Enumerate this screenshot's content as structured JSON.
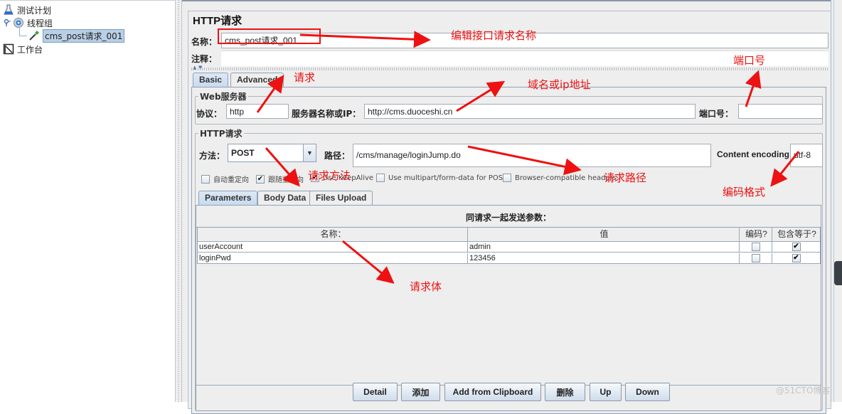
{
  "tree": {
    "items": [
      {
        "label": "测试计划",
        "icon": "flask-icon"
      },
      {
        "label": "线程组",
        "icon": "gear-icon"
      },
      {
        "label": "cms_post请求_001",
        "icon": "pipette-icon",
        "selected": true
      },
      {
        "label": "工作台",
        "icon": "notepad-icon"
      }
    ]
  },
  "panel": {
    "title": "HTTP请求",
    "name_label": "名称：",
    "name_value": "cms_post请求_001",
    "comment_label": "注释：",
    "comment_value": ""
  },
  "tabs": [
    {
      "label": "Basic",
      "active": true
    },
    {
      "label": "Advanced",
      "active": false
    }
  ],
  "web_server": {
    "group_title": "Web服务器",
    "protocol_label": "协议：",
    "protocol_value": "http",
    "server_label": "服务器名称或IP：",
    "server_value": "http://cms.duoceshi.cn",
    "port_label": "端口号：",
    "port_value": ""
  },
  "http_request": {
    "group_title": "HTTP请求",
    "method_label": "方法：",
    "method_value": "POST",
    "path_label": "路径：",
    "path_value": "/cms/manage/loginJump.do",
    "encoding_label": "Content encoding:",
    "encoding_value": "utf-8"
  },
  "options": [
    {
      "label": "自动重定向",
      "checked": false
    },
    {
      "label": "跟随重定向",
      "checked": true
    },
    {
      "label": "Use KeepAlive",
      "checked": true
    },
    {
      "label": "Use multipart/form-data for POST",
      "checked": false
    },
    {
      "label": "Browser-compatible headers",
      "checked": false
    }
  ],
  "sub_tabs": [
    {
      "label": "Parameters",
      "active": true
    },
    {
      "label": "Body Data",
      "active": false
    },
    {
      "label": "Files Upload",
      "active": false
    }
  ],
  "params": {
    "caption": "同请求一起发送参数：",
    "columns": [
      "名称：",
      "值",
      "编码?",
      "包含等于?"
    ],
    "rows": [
      {
        "name": "userAccount",
        "value": "admin",
        "encode": false,
        "include_equals": true
      },
      {
        "name": "loginPwd",
        "value": "123456",
        "encode": false,
        "include_equals": true
      }
    ]
  },
  "buttons": [
    "Detail",
    "添加",
    "Add from Clipboard",
    "删除",
    "Up",
    "Down"
  ],
  "annotations": {
    "edit_name": "编辑接口请求名称",
    "request": "请求",
    "domain": "域名或ip地址",
    "port": "端口号",
    "method": "请求方法",
    "path": "请求路径",
    "encoding": "编码格式",
    "body": "请求体"
  },
  "colors": {
    "annotation": "#ee1111",
    "selection": "#b8cfe5",
    "tab_active": "#c7daf0"
  },
  "watermark": "@51CTO博客"
}
